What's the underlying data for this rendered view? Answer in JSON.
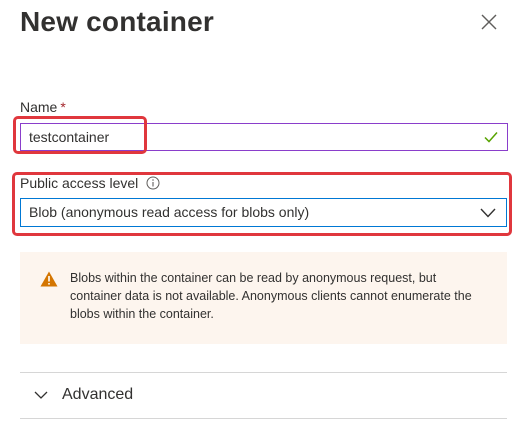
{
  "panel": {
    "title": "New container"
  },
  "name_field": {
    "label": "Name",
    "required_marker": "*",
    "value": "testcontainer"
  },
  "access_field": {
    "label": "Public access level",
    "selected": "Blob (anonymous read access for blobs only)"
  },
  "warning": {
    "text": "Blobs within the container can be read by anonymous request, but container data is not available. Anonymous clients cannot enumerate the blobs within the container."
  },
  "advanced": {
    "label": "Advanced"
  },
  "icons": {
    "close": "close-icon",
    "check": "checkmark-icon",
    "info": "info-icon",
    "chevron": "chevron-down-icon",
    "warning": "warning-icon"
  },
  "colors": {
    "accent_blue": "#0078d4",
    "input_border_valid": "#8a3ecb",
    "success_green": "#57a300",
    "warning_orange": "#d47500",
    "warning_bg": "#fdf5ee",
    "required_red": "#a4262c",
    "highlight_red": "#e0373d"
  }
}
